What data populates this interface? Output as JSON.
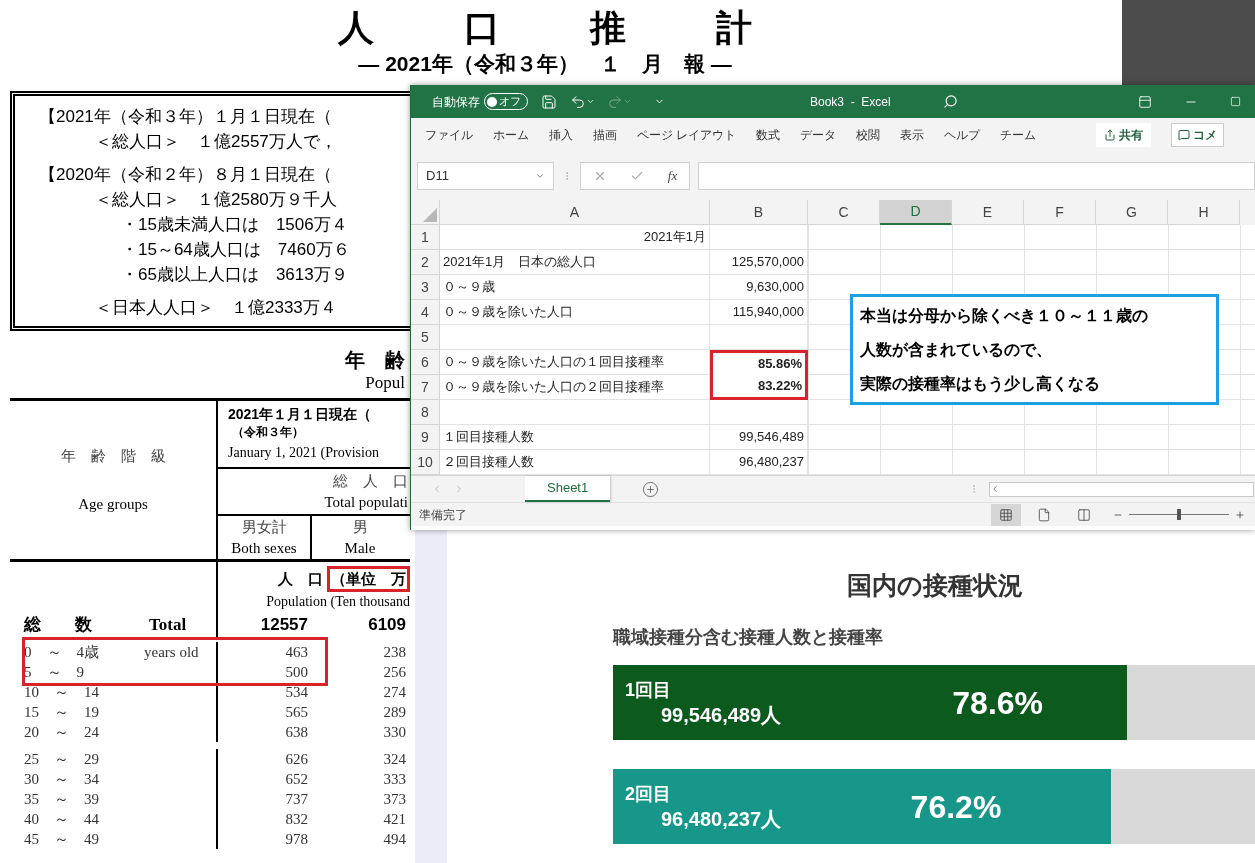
{
  "document": {
    "title": "人　口　推　計",
    "subtitle": "― 2021年（令和３年）　１　月　報 ―",
    "summary": [
      {
        "kind": "heading",
        "text": "【2021年（令和３年）１月１日現在（"
      },
      {
        "kind": "total",
        "text": "＜総人口＞　１億2557万人で，"
      },
      {
        "kind": "heading",
        "text": "【2020年（令和２年）８月１日現在（"
      },
      {
        "kind": "total",
        "text": "＜総人口＞　１億2580万９千人"
      },
      {
        "kind": "bullet",
        "text": "・15歳未満人口は　1506万４"
      },
      {
        "kind": "bullet",
        "text": "・15～64歳人口は　7460万６"
      },
      {
        "kind": "bullet",
        "text": "・65歳以上人口は　3613万９"
      },
      {
        "kind": "total",
        "text": "＜日本人人口＞　１億2333万４"
      }
    ],
    "section_title": "年　齢",
    "section_subtitle": "Popul",
    "table": {
      "age_header": "年　齢　階　級",
      "age_header_en": "Age groups",
      "date_lines": [
        "2021年１月１日現在（",
        "（令和３年）",
        "January 1, 2021  (Provision"
      ],
      "group": "総　人　口",
      "group_en": "Total  populati",
      "columns": [
        {
          "ja": "男女計",
          "en": "Both sexes"
        },
        {
          "ja": "男",
          "en": "Male"
        }
      ],
      "unit": {
        "label": "人　口",
        "value": "（単位　万",
        "en": "Population (Ten thousand",
        "highlighted": true
      },
      "total": {
        "label": "総　　数",
        "en": "Total",
        "values": [
          "12557",
          "6109"
        ]
      },
      "rows": [
        {
          "age": "0　～　4歳",
          "en": "years old",
          "values": [
            "463",
            "238"
          ],
          "highlighted": true
        },
        {
          "age": "5　～　9",
          "values": [
            "500",
            "256"
          ],
          "highlighted": true
        },
        {
          "age": "10　～　14",
          "values": [
            "534",
            "274"
          ],
          "highlighted": false
        },
        {
          "age": "15　～　19",
          "values": [
            "565",
            "289"
          ],
          "highlighted": false
        },
        {
          "age": "20　～　24",
          "values": [
            "638",
            "330"
          ],
          "highlighted": false
        },
        {
          "age": "25　～　29",
          "values": [
            "626",
            "324"
          ],
          "highlighted": false
        },
        {
          "age": "30　～　34",
          "values": [
            "652",
            "333"
          ],
          "highlighted": false
        },
        {
          "age": "35　～　39",
          "values": [
            "737",
            "373"
          ],
          "highlighted": false
        },
        {
          "age": "40　～　44",
          "values": [
            "832",
            "421"
          ],
          "highlighted": false
        },
        {
          "age": "45　～　49",
          "values": [
            "978",
            "494"
          ],
          "highlighted": false
        }
      ]
    }
  },
  "excel": {
    "autosave": {
      "label": "自動保存",
      "state_label": "オフ",
      "on": false
    },
    "title": "Book3  -  Excel",
    "menu": [
      "ファイル",
      "ホーム",
      "挿入",
      "描画",
      "ページ レイアウト",
      "数式",
      "データ",
      "校閲",
      "表示",
      "ヘルプ",
      "チーム"
    ],
    "share": "共有",
    "comment": "コメ",
    "name_box": "D11",
    "function_label": "fx",
    "columns": [
      {
        "label": "A",
        "selected": false
      },
      {
        "label": "B",
        "selected": false
      },
      {
        "label": "C",
        "selected": false
      },
      {
        "label": "D",
        "selected": true
      },
      {
        "label": "E",
        "selected": false
      },
      {
        "label": "F",
        "selected": false
      },
      {
        "label": "G",
        "selected": false
      },
      {
        "label": "H",
        "selected": false
      }
    ],
    "rows": [
      {
        "number": "1",
        "kind": "title",
        "a": "2021年1月",
        "highlighted": false
      },
      {
        "number": "2",
        "kind": "value",
        "a": "2021年1月　日本の総人口",
        "b": "125,570,000",
        "highlighted": false
      },
      {
        "number": "3",
        "kind": "value",
        "a": "０～９歳",
        "b": "9,630,000",
        "highlighted": false
      },
      {
        "number": "4",
        "kind": "value",
        "a": "０～９歳を除いた人口",
        "b": "115,940,000",
        "highlighted": false
      },
      {
        "number": "5",
        "kind": "blank",
        "highlighted": false
      },
      {
        "number": "6",
        "kind": "rate",
        "a": "０～９歳を除いた人口の１回目接種率",
        "b": "85.86%",
        "highlighted": true
      },
      {
        "number": "7",
        "kind": "rate",
        "a": "０～９歳を除いた人口の２回目接種率",
        "b": "83.22%",
        "highlighted": true
      },
      {
        "number": "8",
        "kind": "blank",
        "highlighted": false
      },
      {
        "number": "9",
        "kind": "value",
        "a": "１回目接種人数",
        "b": "99,546,489",
        "highlighted": false
      },
      {
        "number": "10",
        "kind": "value",
        "a": "２回目接種人数",
        "b": "96,480,237",
        "highlighted": false
      }
    ],
    "callout": [
      "本当は分母から除くべき１０～１１歳の",
      "人数が含まれているので、",
      "実際の接種率はもう少し高くなる"
    ],
    "sheet_tabs": [
      {
        "label": "Sheet1",
        "selected": true
      }
    ],
    "status": "準備完了",
    "zoom": {
      "level": 0.5
    }
  },
  "web": {
    "title": "国内の接種状況",
    "subtitle": "職域接種分含む接種人数と接種率",
    "bars": [
      {
        "label": "1回目",
        "count": "99,546,489人",
        "percent": "78.6%",
        "level": 0.786,
        "color": "#0d5a1e"
      },
      {
        "label": "2回目",
        "count": "96,480,237人",
        "percent": "76.2%",
        "level": 0.762,
        "color": "#16978a"
      }
    ]
  }
}
